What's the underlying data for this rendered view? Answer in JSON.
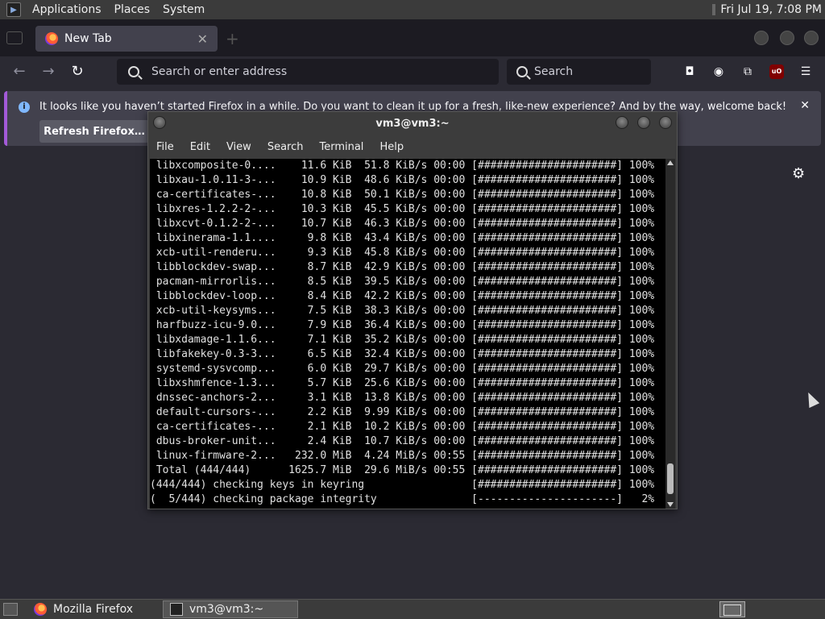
{
  "topbar": {
    "menus": [
      "Applications",
      "Places",
      "System"
    ],
    "clock": "Fri Jul 19,  7:08 PM"
  },
  "firefox": {
    "tab_title": "New Tab",
    "tab_close": "✕",
    "new_tab": "+",
    "url_placeholder": "Search or enter address",
    "search_placeholder": "Search",
    "notification": "It looks like you haven’t started Firefox in a while. Do you want to clean it up for a fresh, like-new experience? And by the way, welcome back!",
    "refresh_button": "Refresh Firefox…",
    "notification_close": "✕",
    "addon_badge": "uO"
  },
  "terminal": {
    "title": "vm3@vm3:~",
    "menus": [
      "File",
      "Edit",
      "View",
      "Search",
      "Terminal",
      "Help"
    ],
    "lines": [
      " libxcomposite-0....    11.6 KiB  51.8 KiB/s 00:00 [######################] 100%",
      " libxau-1.0.11-3-...    10.9 KiB  48.6 KiB/s 00:00 [######################] 100%",
      " ca-certificates-...    10.8 KiB  50.1 KiB/s 00:00 [######################] 100%",
      " libxres-1.2.2-2-...    10.3 KiB  45.5 KiB/s 00:00 [######################] 100%",
      " libxcvt-0.1.2-2-...    10.7 KiB  46.3 KiB/s 00:00 [######################] 100%",
      " libxinerama-1.1....     9.8 KiB  43.4 KiB/s 00:00 [######################] 100%",
      " xcb-util-renderu...     9.3 KiB  45.8 KiB/s 00:00 [######################] 100%",
      " libblockdev-swap...     8.7 KiB  42.9 KiB/s 00:00 [######################] 100%",
      " pacman-mirrorlis...     8.5 KiB  39.5 KiB/s 00:00 [######################] 100%",
      " libblockdev-loop...     8.4 KiB  42.2 KiB/s 00:00 [######################] 100%",
      " xcb-util-keysyms...     7.5 KiB  38.3 KiB/s 00:00 [######################] 100%",
      " harfbuzz-icu-9.0...     7.9 KiB  36.4 KiB/s 00:00 [######################] 100%",
      " libxdamage-1.1.6...     7.1 KiB  35.2 KiB/s 00:00 [######################] 100%",
      " libfakekey-0.3-3...     6.5 KiB  32.4 KiB/s 00:00 [######################] 100%",
      " systemd-sysvcomp...     6.0 KiB  29.7 KiB/s 00:00 [######################] 100%",
      " libxshmfence-1.3...     5.7 KiB  25.6 KiB/s 00:00 [######################] 100%",
      " dnssec-anchors-2...     3.1 KiB  13.8 KiB/s 00:00 [######################] 100%",
      " default-cursors-...     2.2 KiB  9.99 KiB/s 00:00 [######################] 100%",
      " ca-certificates-...     2.1 KiB  10.2 KiB/s 00:00 [######################] 100%",
      " dbus-broker-unit...     2.4 KiB  10.7 KiB/s 00:00 [######################] 100%",
      " linux-firmware-2...   232.0 MiB  4.24 MiB/s 00:55 [######################] 100%",
      " Total (444/444)      1625.7 MiB  29.6 MiB/s 00:55 [######################] 100%",
      "(444/444) checking keys in keyring                 [######################] 100%",
      "(  5/444) checking package integrity               [----------------------]   2%"
    ]
  },
  "taskbar": {
    "tasks": [
      "Mozilla Firefox",
      "vm3@vm3:~"
    ]
  }
}
